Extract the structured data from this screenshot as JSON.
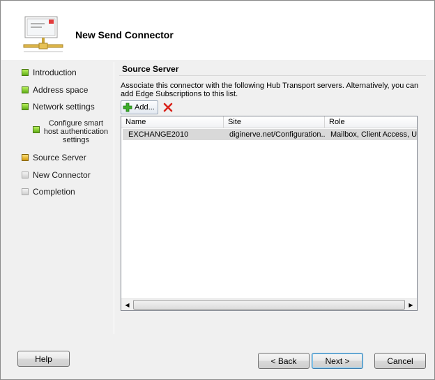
{
  "wizard": {
    "title": "New Send Connector",
    "steps": [
      {
        "label": "Introduction",
        "state": "done"
      },
      {
        "label": "Address space",
        "state": "done"
      },
      {
        "label": "Network settings",
        "state": "done"
      },
      {
        "label": "Configure smart host authentication settings",
        "state": "done"
      },
      {
        "label": "Source Server",
        "state": "current"
      },
      {
        "label": "New Connector",
        "state": "pending"
      },
      {
        "label": "Completion",
        "state": "pending"
      }
    ]
  },
  "page": {
    "title": "Source Server",
    "description": "Associate this connector with the following Hub Transport servers. Alternatively, you can add Edge Subscriptions to this list."
  },
  "toolbar": {
    "add_label": "Add...",
    "add_icon": "add-icon",
    "remove_icon": "delete-icon"
  },
  "table": {
    "columns": [
      "Name",
      "Site",
      "Role"
    ],
    "rows": [
      [
        "EXCHANGE2010",
        "diginerve.net/Configuration...",
        "Mailbox, Client Access, Un"
      ]
    ]
  },
  "buttons": {
    "help": "Help",
    "back": "< Back",
    "next": "Next >",
    "cancel": "Cancel"
  },
  "colors": {
    "step_done": "#5fae17",
    "step_current": "#d49a0a",
    "step_pending": "#cfcfcf",
    "selected_row": "#d9d9d9"
  }
}
